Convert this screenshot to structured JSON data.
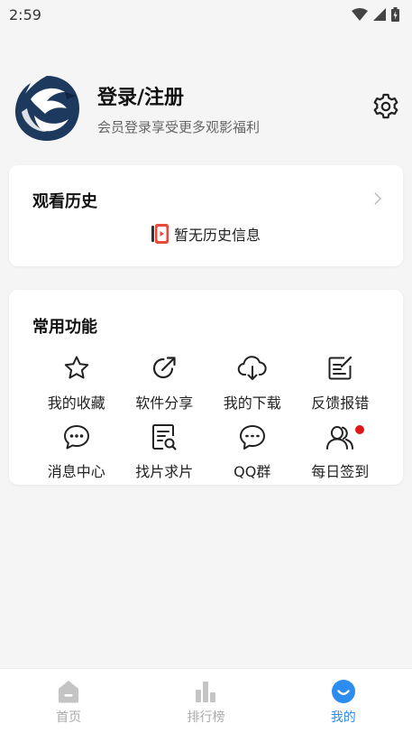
{
  "status": {
    "time": "2:59"
  },
  "profile": {
    "title": "登录/注册",
    "subtitle": "会员登录享受更多观影福利"
  },
  "history": {
    "title": "观看历史",
    "empty_text": "暂无历史信息"
  },
  "functions": {
    "title": "常用功能",
    "items": [
      {
        "label": "我的收藏",
        "icon": "star-icon"
      },
      {
        "label": "软件分享",
        "icon": "share-icon"
      },
      {
        "label": "我的下载",
        "icon": "cloud-download-icon"
      },
      {
        "label": "反馈报错",
        "icon": "edit-note-icon"
      },
      {
        "label": "消息中心",
        "icon": "chat-icon"
      },
      {
        "label": "找片求片",
        "icon": "search-document-icon"
      },
      {
        "label": "QQ群",
        "icon": "chat-bubble-icon"
      },
      {
        "label": "每日签到",
        "icon": "people-icon"
      }
    ]
  },
  "tabs": [
    {
      "label": "首页",
      "icon": "home-icon",
      "active": false
    },
    {
      "label": "排行榜",
      "icon": "bar-chart-icon",
      "active": false
    },
    {
      "label": "我的",
      "icon": "smile-icon",
      "active": true
    }
  ],
  "colors": {
    "accent": "#2d8cf0",
    "badge": "#e01515",
    "background": "#f5f5f5"
  }
}
